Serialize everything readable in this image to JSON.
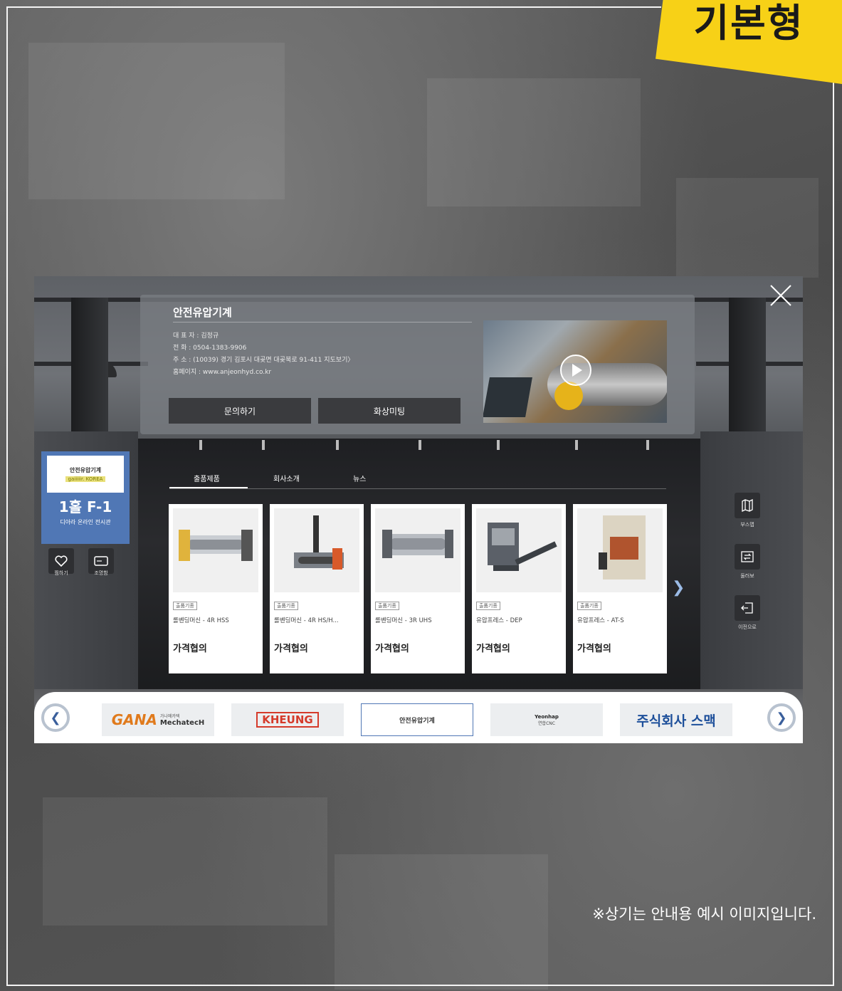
{
  "badge": {
    "label": "기본형"
  },
  "note": "※상기는 안내용 예시 이미지입니다.",
  "company": {
    "name": "안전유압기계",
    "rep": "대 표 자 : 김정규",
    "phone": "전   화 : 0504-1383-9906",
    "address": "주   소 : (10039) 경기 김포시 대곶면 대곶북로 91-411 지도보기〉",
    "homepage": "홈페이지 : www.anjeonhyd.co.kr"
  },
  "buttons": {
    "inquiry": "문의하기",
    "meeting": "화상미팅"
  },
  "booth": {
    "logo_name": "안전유압기계",
    "logo_sub": "gaiiiiir. KOREA",
    "number": "1홀 F-1",
    "subtitle": "디아라 온라인 전시관",
    "like_label": "찜하기",
    "guide_label": "조명함"
  },
  "tabs": [
    "출품제품",
    "회사소개",
    "뉴스"
  ],
  "products": [
    {
      "tag": "출품기종",
      "name": "롤벤딩머신 - 4R HSS",
      "price": "가격협의"
    },
    {
      "tag": "출품기종",
      "name": "롤벤딩머신 - 4R HS/H...",
      "price": "가격협의"
    },
    {
      "tag": "출품기종",
      "name": "롤벤딩머신 - 3R UHS",
      "price": "가격협의"
    },
    {
      "tag": "출품기종",
      "name": "유압프레스 - DEP",
      "price": "가격협의"
    },
    {
      "tag": "출품기종",
      "name": "유압프레스 - AT-S",
      "price": "가격협의"
    }
  ],
  "right_menu": [
    {
      "icon": "map-icon",
      "label": "부스맵"
    },
    {
      "icon": "swap-icon",
      "label": "둘러보"
    },
    {
      "icon": "exit-icon",
      "label": "이전으로"
    }
  ],
  "brands": [
    {
      "name": "GANA",
      "sub": "가나메카텍",
      "sub2": "MechatecH"
    },
    {
      "name": "KHEUNG"
    },
    {
      "name": "안전유압기계"
    },
    {
      "name": "Yeonhap",
      "sub": "연합CNC"
    },
    {
      "name": "주식회사 스맥"
    }
  ],
  "colors": {
    "accent": "#f7d117",
    "booth_blue": "#5077b5"
  }
}
